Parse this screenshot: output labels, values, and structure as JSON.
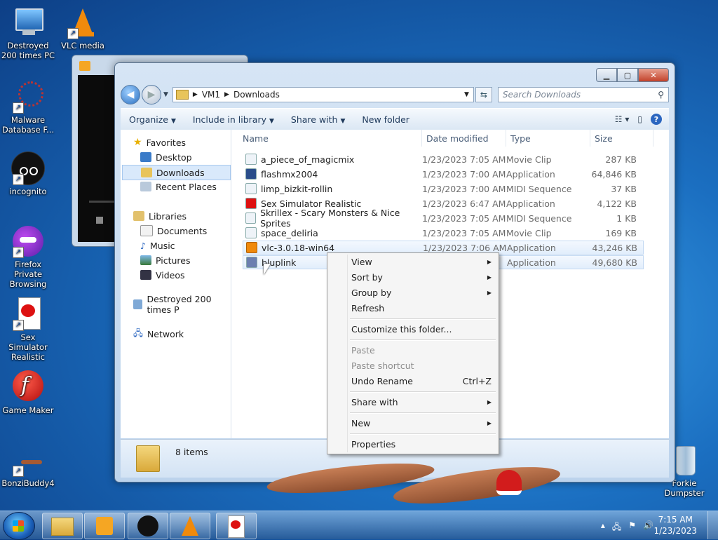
{
  "desktop": {
    "icons": [
      {
        "label": "Destroyed 200 times PC",
        "icon": "computer-icon"
      },
      {
        "label": "VLC media",
        "icon": "vlc-icon"
      },
      {
        "label": "Malware Database F...",
        "icon": "malware-icon"
      },
      {
        "label": "incognito",
        "icon": "incognito-icon"
      },
      {
        "label": "Firefox Private Browsing",
        "icon": "firefox-private-icon"
      },
      {
        "label": "Sex Simulator Realistic",
        "icon": "document-icon"
      },
      {
        "label": "Game Maker",
        "icon": "flash-icon"
      },
      {
        "label": "BonziBuddy4",
        "icon": "lizard-icon"
      },
      {
        "label": "Forkie Dumpster",
        "icon": "recycle-bin-icon"
      }
    ]
  },
  "explorer": {
    "breadcrumb": [
      "VM1",
      "Downloads"
    ],
    "search_placeholder": "Search Downloads",
    "toolbar": {
      "organize": "Organize",
      "include": "Include in library",
      "share": "Share with",
      "new_folder": "New folder"
    },
    "nav": {
      "favorites": "Favorites",
      "desktop": "Desktop",
      "downloads": "Downloads",
      "recent": "Recent Places",
      "libraries": "Libraries",
      "documents": "Documents",
      "music": "Music",
      "pictures": "Pictures",
      "videos": "Videos",
      "computer": "Destroyed 200 times P",
      "network": "Network"
    },
    "columns": {
      "name": "Name",
      "date": "Date modified",
      "type": "Type",
      "size": "Size"
    },
    "files": [
      {
        "name": "a_piece_of_magicmix",
        "date": "1/23/2023 7:05 AM",
        "type": "Movie Clip",
        "size": "287 KB"
      },
      {
        "name": "flashmx2004",
        "date": "1/23/2023 7:00 AM",
        "type": "Application",
        "size": "64,846 KB"
      },
      {
        "name": "limp_bizkit-rollin",
        "date": "1/23/2023 7:00 AM",
        "type": "MIDI Sequence",
        "size": "37 KB"
      },
      {
        "name": "Sex Simulator Realistic",
        "date": "1/23/2023 6:47 AM",
        "type": "Application",
        "size": "4,122 KB"
      },
      {
        "name": "Skrillex - Scary Monsters & Nice Sprites",
        "date": "1/23/2023 7:05 AM",
        "type": "MIDI Sequence",
        "size": "1 KB"
      },
      {
        "name": "space_deliria",
        "date": "1/23/2023 7:05 AM",
        "type": "Movie Clip",
        "size": "169 KB"
      },
      {
        "name": "vlc-3.0.18-win64",
        "date": "1/23/2023 7:06 AM",
        "type": "Application",
        "size": "43,246 KB"
      },
      {
        "name": "bluplink",
        "date": "",
        "type": "Application",
        "size": "49,680 KB"
      }
    ],
    "status": "8 items"
  },
  "context_menu": {
    "view": "View",
    "sort_by": "Sort by",
    "group_by": "Group by",
    "refresh": "Refresh",
    "customize": "Customize this folder...",
    "paste": "Paste",
    "paste_shortcut": "Paste shortcut",
    "undo_rename": "Undo Rename",
    "undo_shortcut": "Ctrl+Z",
    "share_with": "Share with",
    "new": "New",
    "properties": "Properties"
  },
  "taskbar": {
    "time": "7:15 AM",
    "date": "1/23/2023",
    "buttons": [
      "explorer-icon",
      "media-player-icon",
      "incognito-icon",
      "vlc-icon",
      "document-icon"
    ]
  }
}
